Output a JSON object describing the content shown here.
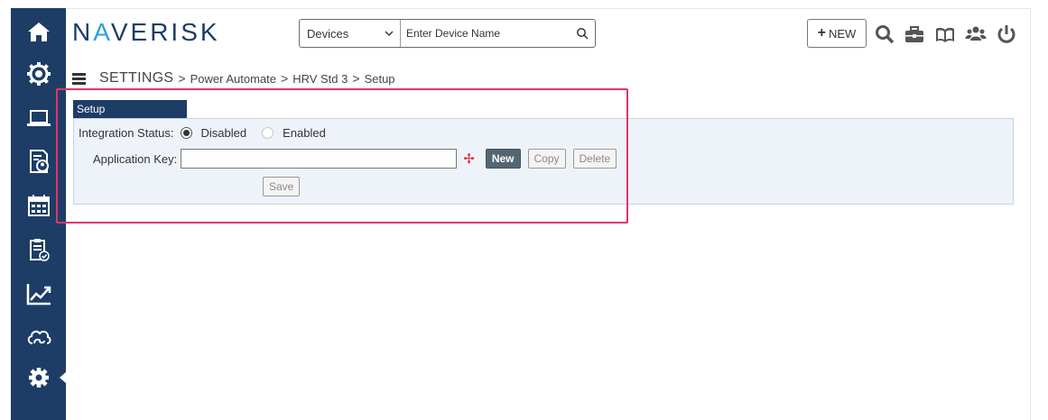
{
  "brand": {
    "prefix": "N",
    "accent": "A",
    "suffix": "VERISK",
    "color": "#1d3d66",
    "accent_color": "#2ba0d8"
  },
  "sidebar": {
    "items": [
      {
        "icon": "home-icon"
      },
      {
        "icon": "gear-cog-icon"
      },
      {
        "icon": "laptop-icon"
      },
      {
        "icon": "person-doc-icon"
      },
      {
        "icon": "calendar-icon"
      },
      {
        "icon": "clipboard-check-icon"
      },
      {
        "icon": "chart-line-icon"
      },
      {
        "icon": "cloud-icon"
      },
      {
        "icon": "settings-gear-icon",
        "active": true
      }
    ]
  },
  "search": {
    "category": "Devices",
    "placeholder": "Enter Device Name"
  },
  "header": {
    "new_label": "NEW"
  },
  "breadcrumb": {
    "root": "SETTINGS",
    "items": [
      "Power Automate",
      "HRV Std 3",
      "Setup"
    ],
    "separator": ">"
  },
  "setup": {
    "tab_label": "Setup",
    "integration_status_label": "Integration Status:",
    "option_disabled": "Disabled",
    "option_enabled": "Enabled",
    "selected": "Disabled",
    "app_key_label": "Application Key:",
    "app_key_value": "",
    "required_marker": "✢",
    "new_button": "New",
    "copy_button": "Copy",
    "delete_button": "Delete",
    "save_button": "Save"
  },
  "colors": {
    "sidebar": "#1d3d66",
    "panel_bg": "#eef3fa",
    "highlight": "#e0346b",
    "required": "#e0202a"
  }
}
